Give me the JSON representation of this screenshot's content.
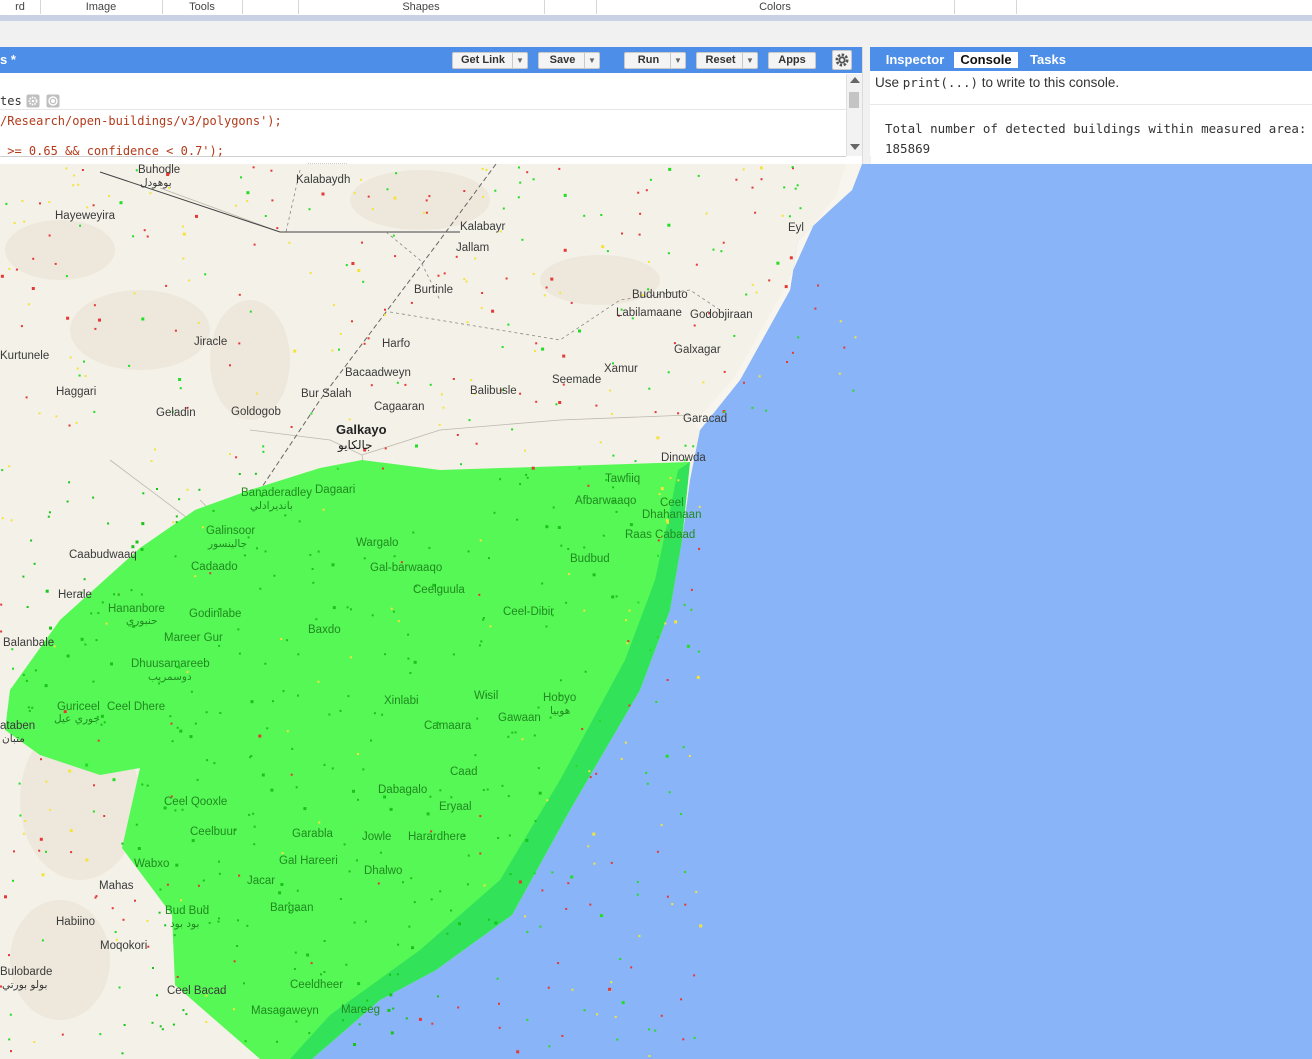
{
  "ribbon": {
    "groups": [
      "rd",
      "Image",
      "Tools",
      "Shapes",
      "Colors"
    ]
  },
  "editor": {
    "script_title": "s *",
    "buttons": {
      "get_link": "Get Link",
      "save": "Save",
      "run": "Run",
      "reset": "Reset",
      "apps": "Apps"
    },
    "imports_label": "tes",
    "code_lines": [
      "/Research/open-buildings/v3/polygons');",
      " >= 0.65 && confidence < 0.7');"
    ]
  },
  "right_panel": {
    "tabs": [
      "Inspector",
      "Console",
      "Tasks"
    ],
    "active_tab": "Console",
    "console_hint_pre": "Use ",
    "console_hint_code": "print(...)",
    "console_hint_post": " to write to this console.",
    "output_label": "Total number of detected buildings within measured area:",
    "output_value": "185869"
  },
  "map": {
    "colors": {
      "land": "#f4f1e8",
      "ocean": "#8ab4f8",
      "polygon_fill": "#55f855",
      "polygon_coast": "#32e35a"
    },
    "place_labels": [
      "Buhodle",
      "Kalabaydh",
      "Hayeweyira",
      "Kalabayr",
      "Jallam",
      "Eyl",
      "Burtinle",
      "Budunbuto",
      "Labilamaane",
      "Godobjiraan",
      "Jiracle",
      "Harfo",
      "Galxagar",
      "Kurtunele",
      "Bacaadweyn",
      "Xamur",
      "Seemade",
      "Haggari",
      "Balibusle",
      "Bur Salah",
      "Geladin",
      "Goldogob",
      "Cagaaran",
      "Garacad",
      "Galkayo",
      "Dinowda",
      "Banaderadley",
      "Dagaari",
      "Tawfiiq",
      "Afbarwaaqo",
      "Ceel",
      "Dhahanaan",
      "Galinsoor",
      "Raas Cabaad",
      "Wargalo",
      "Caabudwaaq",
      "Budbud",
      "Cadaado",
      "Gal-barwaaqo",
      "Herale",
      "Ceelguula",
      "Hananbore",
      "Godinlabe",
      "Ceel-Dibir",
      "Balanbale",
      "Mareer Gur",
      "Baxdo",
      "Dhuusamareeb",
      "Xinlabi",
      "Wisil",
      "Hobyo",
      "Guriceel",
      "Ceel Dhere",
      "Gawaan",
      "ataben",
      "Camaara",
      "Caad",
      "Dabagalo",
      "Ceel Qooxle",
      "Eryaal",
      "Ceelbuur",
      "Garabla",
      "Jowle",
      "Harardhere",
      "Gal Hareeri",
      "Wabxo",
      "Dhalwo",
      "Jacar",
      "Mahas",
      "Bargaan",
      "Bud Bud",
      "Habiino",
      "Moqokori",
      "Bulobarde",
      "Ceeldheer",
      "Ceel Bacad",
      "Masagaweyn",
      "Mareeg"
    ],
    "arabic_labels": [
      "بوهودل",
      "جالكايو",
      "بانديرادلي",
      "جالينسور",
      "حنبوري",
      "دوسمريب",
      "هوبيا",
      "جوري عيل",
      "متبان",
      "بود بود",
      "بولو بورتي"
    ]
  }
}
